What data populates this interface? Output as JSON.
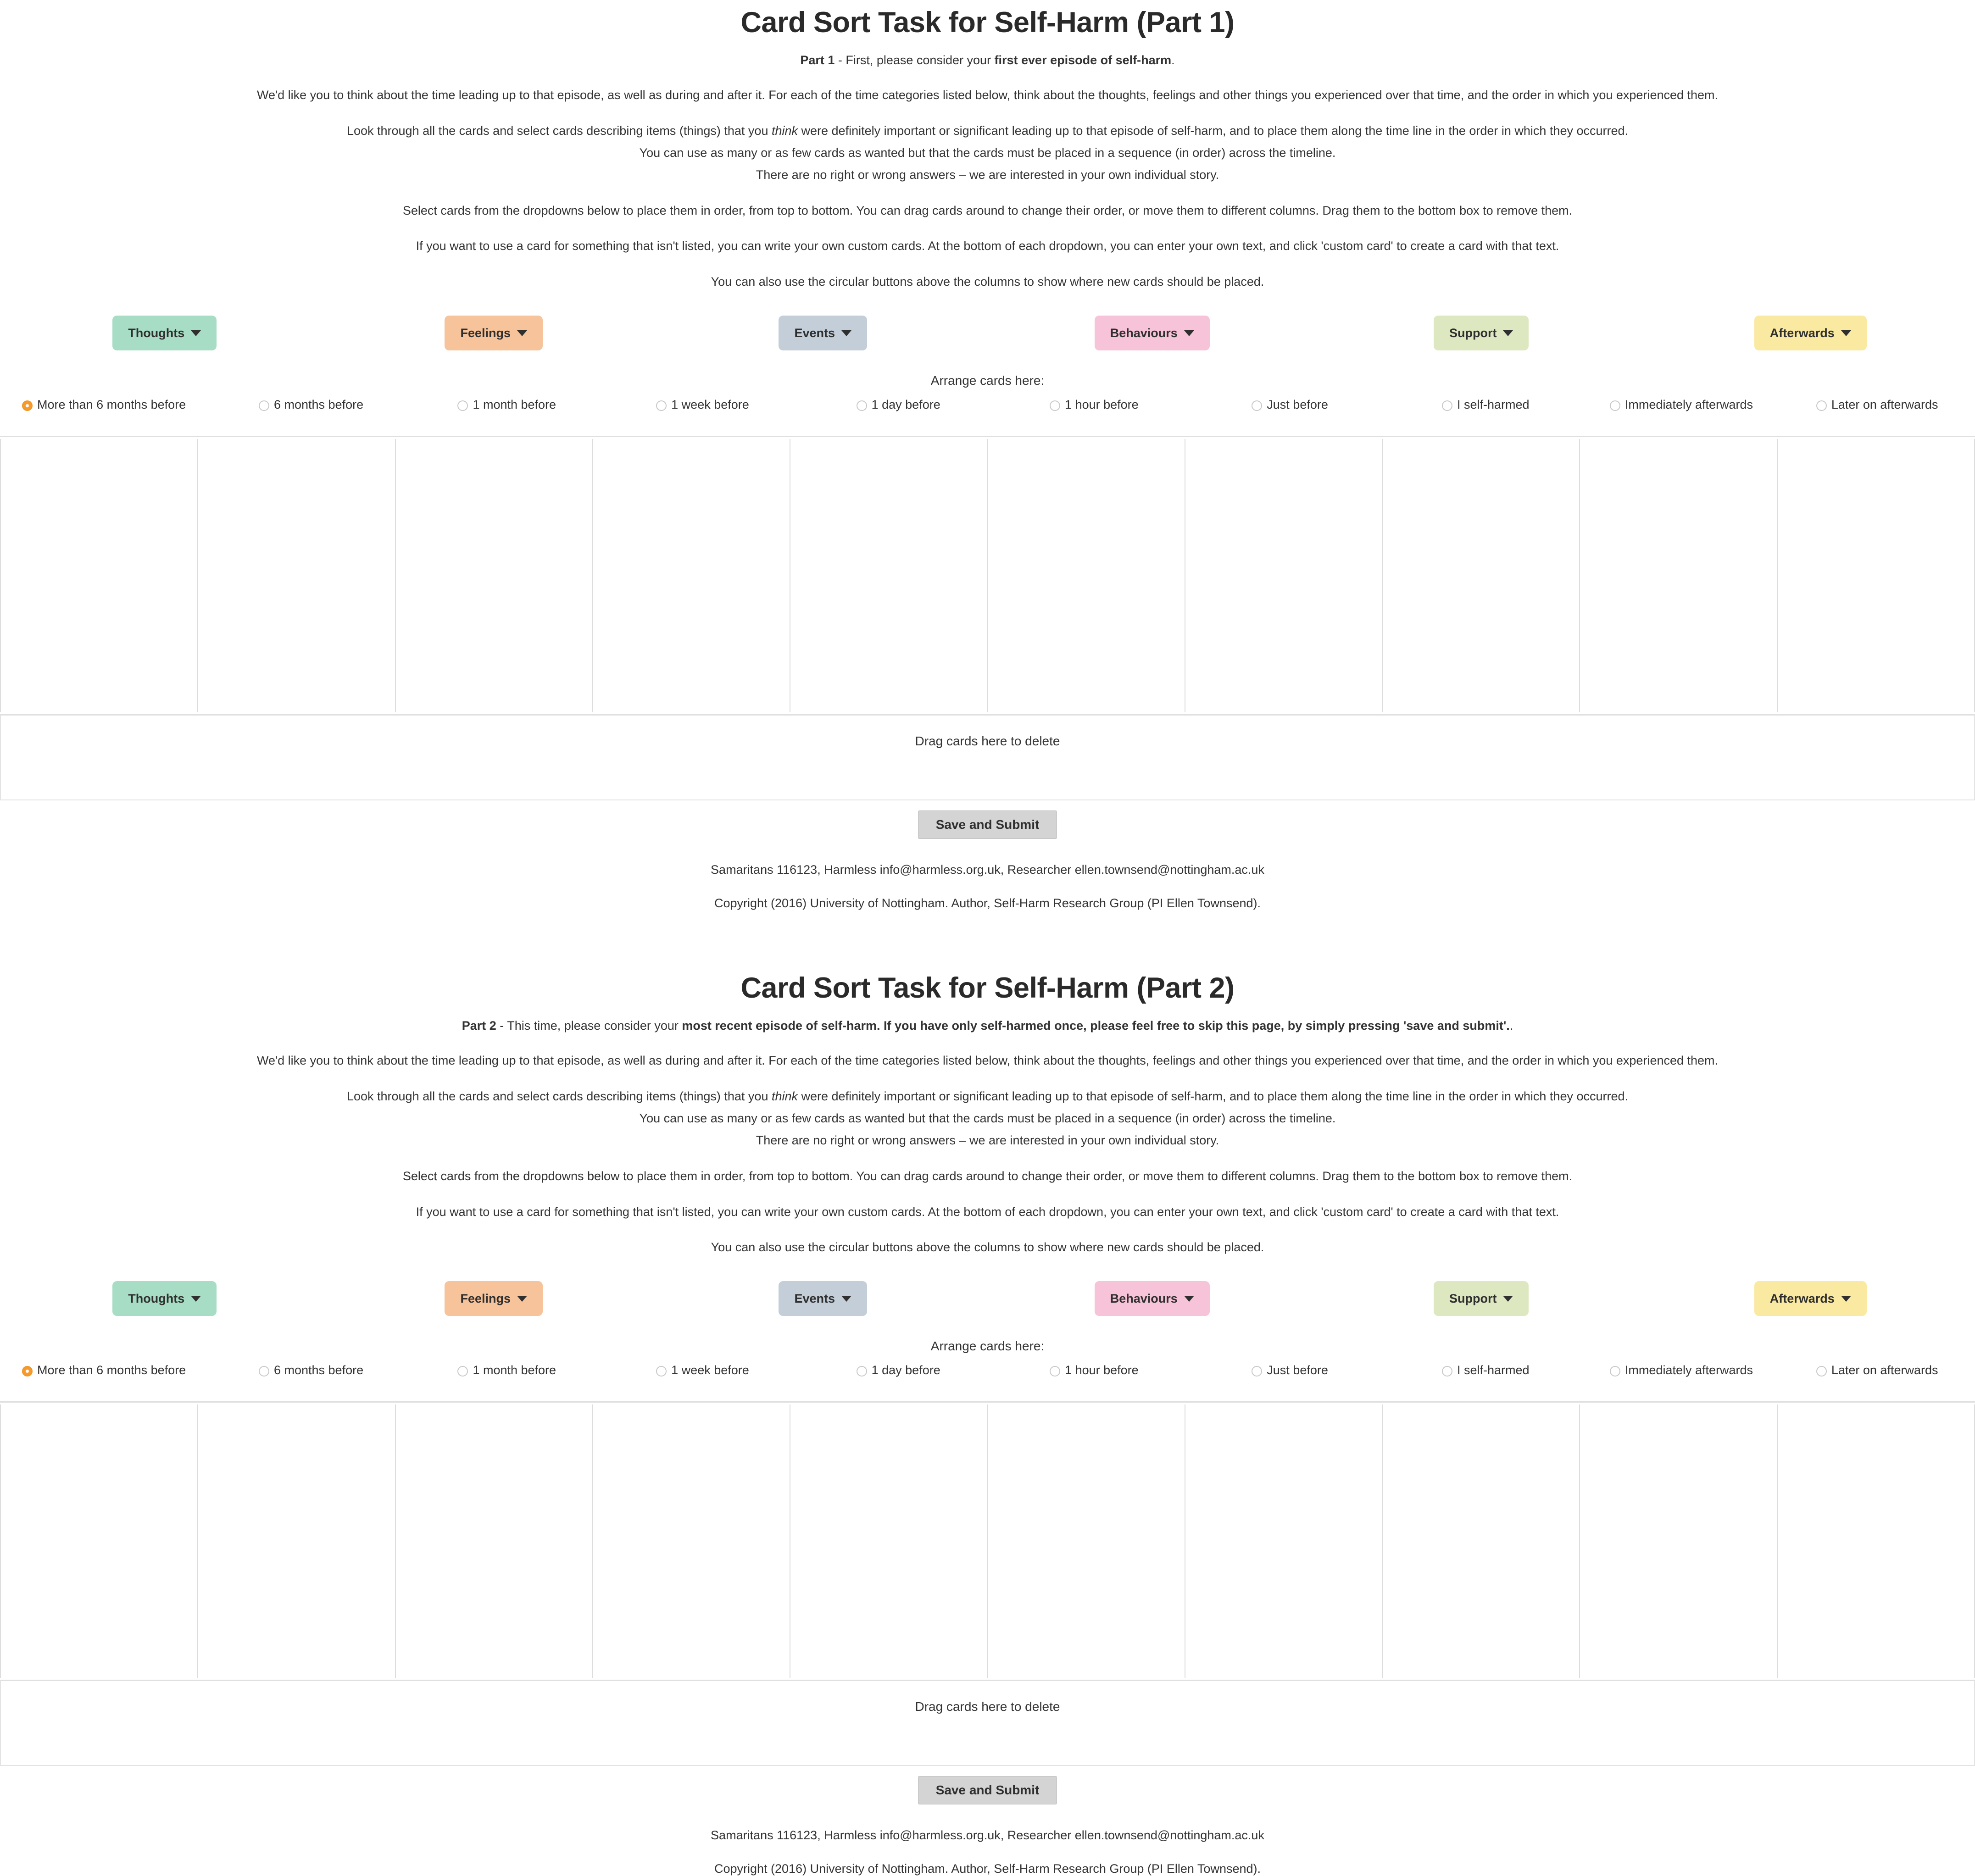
{
  "colors": {
    "thoughts": "#a8ddc5",
    "feelings": "#f7c39a",
    "events": "#c3ced9",
    "behaviours": "#f7c3d8",
    "support": "#dde8c0",
    "afterwards": "#fae9a0",
    "radio_selected": "#f79a2b",
    "grid_border": "#dddddd",
    "submit_bg": "#d4d4d4"
  },
  "parts": [
    {
      "title": "Card Sort Task for Self-Harm (Part 1)",
      "subtitle_prefix": "Part 1",
      "subtitle_mid": " - First, please consider your ",
      "subtitle_bold": "first ever episode of self-harm",
      "subtitle_suffix": ".",
      "paragraphs": {
        "p1": "We'd like you to think about the time leading up to that episode, as well as during and after it. For each of the time categories listed below, think about the thoughts, feelings and other things you experienced over that time, and the order in which you experienced them.",
        "p2_a": "Look through all the cards and select cards describing items (things) that you ",
        "p2_i": "think",
        "p2_b": " were definitely important or significant leading up to that episode of self-harm, and to place them along the time line in the order in which they occurred.",
        "p3": "You can use as many or as few cards as wanted but that the cards must be placed in a sequence (in order) across the timeline.",
        "p4": "There are no right or wrong answers – we are interested in your own individual story.",
        "p5": "Select cards from the dropdowns below to place them in order, from top to bottom. You can drag cards around to change their order, or move them to different columns. Drag them to the bottom box to remove them.",
        "p6": "If you want to use a card for something that isn't listed, you can write your own custom cards. At the bottom of each dropdown, you can enter your own text, and click 'custom card' to create a card with that text.",
        "p7": "You can also use the circular buttons above the columns to show where new cards should be placed."
      }
    },
    {
      "title": "Card Sort Task for Self-Harm (Part 2)",
      "subtitle_prefix": "Part 2",
      "subtitle_mid": " - This time, please consider your ",
      "subtitle_bold": "most recent episode of self-harm. If you have only self-harmed once, please feel free to skip this page, by simply pressing 'save and submit'.",
      "subtitle_suffix": ".",
      "paragraphs": {
        "p1": "We'd like you to think about the time leading up to that episode, as well as during and after it. For each of the time categories listed below, think about the thoughts, feelings and other things you experienced over that time, and the order in which you experienced them.",
        "p2_a": "Look through all the cards and select cards describing items (things) that you ",
        "p2_i": "think",
        "p2_b": " were definitely important or significant leading up to that episode of self-harm, and to place them along the time line in the order in which they occurred.",
        "p3": "You can use as many or as few cards as wanted but that the cards must be placed in a sequence (in order) across the timeline.",
        "p4": "There are no right or wrong answers – we are interested in your own individual story.",
        "p5": "Select cards from the dropdowns below to place them in order, from top to bottom. You can drag cards around to change their order, or move them to different columns. Drag them to the bottom box to remove them.",
        "p6": "If you want to use a card for something that isn't listed, you can write your own custom cards. At the bottom of each dropdown, you can enter your own text, and click 'custom card' to create a card with that text.",
        "p7": "You can also use the circular buttons above the columns to show where new cards should be placed."
      }
    }
  ],
  "categories": [
    {
      "label": "Thoughts",
      "color": "#a8ddc5",
      "icon": "chevron-down-icon"
    },
    {
      "label": "Feelings",
      "color": "#f7c39a",
      "icon": "chevron-down-icon"
    },
    {
      "label": "Events",
      "color": "#c3ced9",
      "icon": "chevron-down-icon"
    },
    {
      "label": "Behaviours",
      "color": "#f7c3d8",
      "icon": "chevron-down-icon"
    },
    {
      "label": "Support",
      "color": "#dde8c0",
      "icon": "chevron-down-icon"
    },
    {
      "label": "Afterwards",
      "color": "#fae9a0",
      "icon": "chevron-down-icon"
    }
  ],
  "arrange_label": "Arrange cards here:",
  "timeline_columns": [
    {
      "label": "More than 6 months before",
      "selected": true
    },
    {
      "label": "6 months before",
      "selected": false
    },
    {
      "label": "1 month before",
      "selected": false
    },
    {
      "label": "1 week before",
      "selected": false
    },
    {
      "label": "1 day before",
      "selected": false
    },
    {
      "label": "1 hour before",
      "selected": false
    },
    {
      "label": "Just before",
      "selected": false
    },
    {
      "label": "I self-harmed",
      "selected": false
    },
    {
      "label": "Immediately afterwards",
      "selected": false
    },
    {
      "label": "Later on afterwards",
      "selected": false
    }
  ],
  "delete_zone_label": "Drag cards here to delete",
  "submit_label": "Save and Submit",
  "footer": {
    "contacts": "Samaritans 116123, Harmless info@harmless.org.uk, Researcher ellen.townsend@nottingham.ac.uk",
    "copyright": "Copyright (2016) University of Nottingham. Author, Self-Harm Research Group (PI Ellen Townsend)."
  }
}
